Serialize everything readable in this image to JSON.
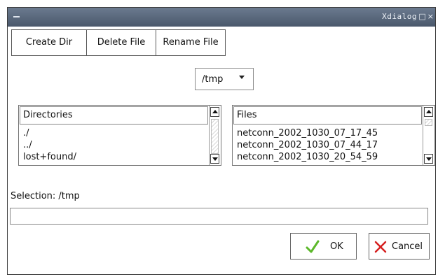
{
  "window": {
    "title": "Xdialog"
  },
  "toolbar": {
    "create_dir": "Create Dir",
    "delete_file": "Delete File",
    "rename_file": "Rename File"
  },
  "path_dropdown": {
    "value": "/tmp"
  },
  "directories": {
    "header": "Directories",
    "items": [
      "./",
      "../",
      "lost+found/"
    ]
  },
  "files": {
    "header": "Files",
    "items": [
      "netconn_2002_1030_07_17_45",
      "netconn_2002_1030_07_44_17",
      "netconn_2002_1030_20_54_59"
    ]
  },
  "selection": {
    "label": "Selection: /tmp",
    "value": ""
  },
  "buttons": {
    "ok": "OK",
    "cancel": "Cancel"
  },
  "colors": {
    "titlebar": "#5a687c",
    "ok_check": "#5cb82a",
    "cancel_x": "#d62020"
  },
  "icons": {
    "ok": "checkmark-icon",
    "cancel": "x-icon"
  }
}
